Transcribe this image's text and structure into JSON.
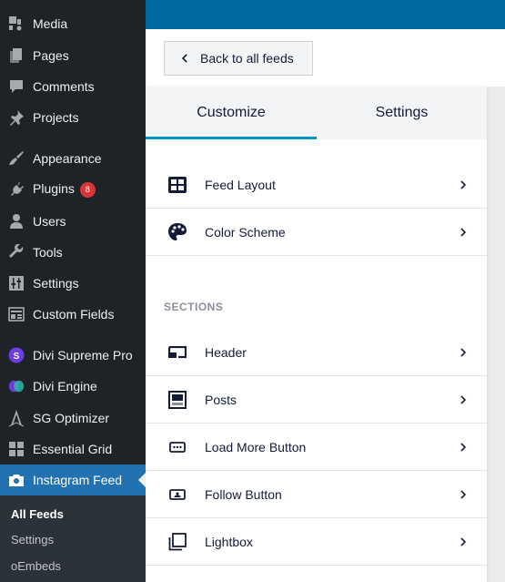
{
  "sidebar": {
    "items": [
      {
        "label": "Media",
        "icon": "media-icon"
      },
      {
        "label": "Pages",
        "icon": "pages-icon"
      },
      {
        "label": "Comments",
        "icon": "comments-icon"
      },
      {
        "label": "Projects",
        "icon": "pin-icon"
      },
      {
        "label": "Appearance",
        "icon": "paintbrush-icon"
      },
      {
        "label": "Plugins",
        "icon": "plugin-icon",
        "badge": "8"
      },
      {
        "label": "Users",
        "icon": "users-icon"
      },
      {
        "label": "Tools",
        "icon": "wrench-icon"
      },
      {
        "label": "Settings",
        "icon": "settings-sliders-icon"
      },
      {
        "label": "Custom Fields",
        "icon": "custom-fields-icon"
      },
      {
        "label": "Divi Supreme Pro",
        "icon": "divi-supreme-icon"
      },
      {
        "label": "Divi Engine",
        "icon": "divi-engine-icon"
      },
      {
        "label": "SG Optimizer",
        "icon": "sg-optimizer-icon"
      },
      {
        "label": "Essential Grid",
        "icon": "grid-icon"
      },
      {
        "label": "Instagram Feed",
        "icon": "camera-icon",
        "active": true
      }
    ],
    "submenu": [
      {
        "label": "All Feeds",
        "current": true
      },
      {
        "label": "Settings"
      },
      {
        "label": "oEmbeds"
      }
    ]
  },
  "colors": {
    "sidebar_bg": "#1d2327",
    "active_bg": "#2271b1",
    "topbar": "#006ba1",
    "tab_underline": "#0096cc",
    "badge": "#d63638",
    "text_dark": "#141b38"
  },
  "back_button": {
    "label": "Back to all feeds"
  },
  "tabs": [
    {
      "label": "Customize",
      "active": true
    },
    {
      "label": "Settings"
    }
  ],
  "general_items": [
    {
      "label": "Feed Layout",
      "icon": "layout-grid-icon"
    },
    {
      "label": "Color Scheme",
      "icon": "palette-icon"
    }
  ],
  "sections_title": "SECTIONS",
  "section_items": [
    {
      "label": "Header",
      "icon": "header-icon"
    },
    {
      "label": "Posts",
      "icon": "posts-icon"
    },
    {
      "label": "Load More Button",
      "icon": "load-more-icon"
    },
    {
      "label": "Follow Button",
      "icon": "follow-button-icon"
    },
    {
      "label": "Lightbox",
      "icon": "lightbox-icon"
    }
  ]
}
